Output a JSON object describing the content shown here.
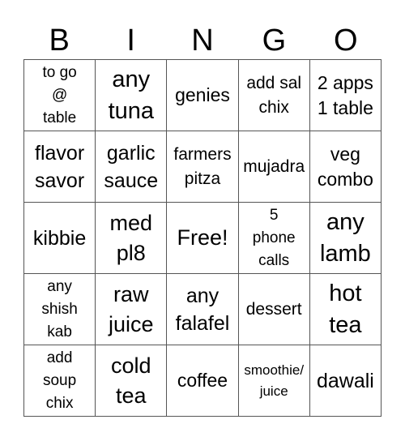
{
  "header": [
    "B",
    "I",
    "N",
    "G",
    "O"
  ],
  "cells": [
    [
      "to go\n@\ntable",
      "any\ntuna",
      "genies",
      "add sal\nchix",
      "2 apps\n1 table"
    ],
    [
      "flavor\nsavor",
      "garlic\nsauce",
      "farmers\npitza",
      "mujadra",
      "veg\ncombo"
    ],
    [
      "kibbie",
      "med\npl8",
      "Free!",
      "5\nphone\ncalls",
      "any\nlamb"
    ],
    [
      "any\nshish\nkab",
      "raw\njuice",
      "any\nfalafel",
      "dessert",
      "hot\ntea"
    ],
    [
      "add\nsoup\nchix",
      "cold\ntea",
      "coffee",
      "smoothie/\njuice",
      "dawali"
    ]
  ]
}
